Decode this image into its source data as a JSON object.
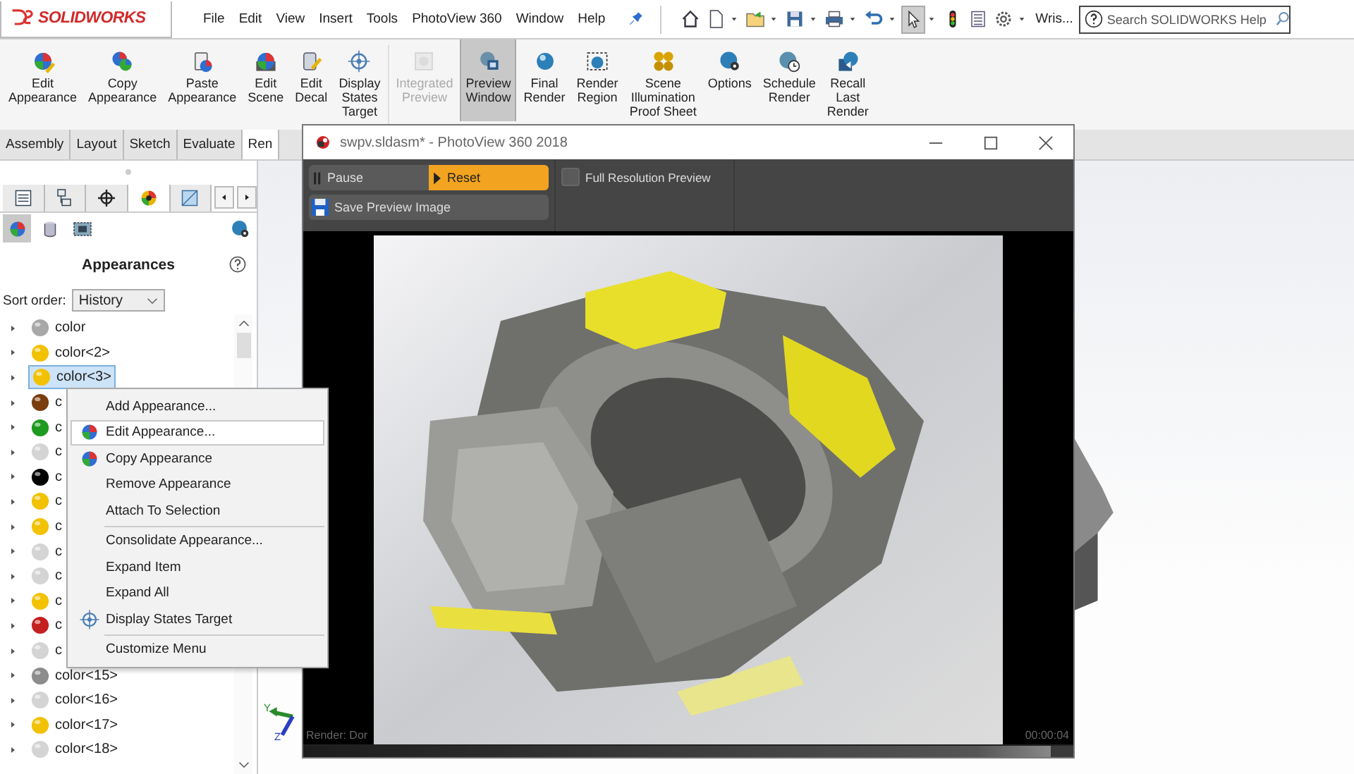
{
  "app": {
    "logo": "SOLIDWORKS"
  },
  "menu": [
    "File",
    "Edit",
    "View",
    "Insert",
    "Tools",
    "PhotoView 360",
    "Window",
    "Help"
  ],
  "quick_access": [
    {
      "selected": false
    },
    {
      "selected": false
    },
    {
      "selected": false
    },
    {
      "selected": false
    },
    {
      "selected": false
    },
    {
      "selected": false
    },
    {
      "selected": true
    },
    {
      "selected": false
    },
    {
      "selected": false
    },
    {
      "selected": false
    }
  ],
  "document_name": "Wris...",
  "search": {
    "placeholder": "Search SOLIDWORKS Help"
  },
  "ribbon": [
    {
      "lines": [
        "Edit",
        "Appearance"
      ],
      "selected": false,
      "disabled": false
    },
    {
      "lines": [
        "Copy",
        "Appearance"
      ],
      "selected": false,
      "disabled": false
    },
    {
      "lines": [
        "Paste",
        "Appearance"
      ],
      "selected": false,
      "disabled": false
    },
    {
      "lines": [
        "Edit",
        "Scene"
      ],
      "selected": false,
      "disabled": false
    },
    {
      "lines": [
        "Edit",
        "Decal"
      ],
      "selected": false,
      "disabled": false
    },
    {
      "lines": [
        "Display",
        "States",
        "Target"
      ],
      "selected": false,
      "disabled": false
    },
    {
      "lines": [
        "Integrated",
        "Preview"
      ],
      "selected": false,
      "disabled": true
    },
    {
      "lines": [
        "Preview",
        "Window"
      ],
      "selected": true,
      "disabled": false
    },
    {
      "lines": [
        "Final",
        "Render"
      ],
      "selected": false,
      "disabled": false
    },
    {
      "lines": [
        "Render",
        "Region"
      ],
      "selected": false,
      "disabled": false
    },
    {
      "lines": [
        "Scene",
        "Illumination",
        "Proof Sheet"
      ],
      "selected": false,
      "disabled": false
    },
    {
      "lines": [
        "Options"
      ],
      "selected": false,
      "disabled": false
    },
    {
      "lines": [
        "Schedule",
        "Render"
      ],
      "selected": false,
      "disabled": false
    },
    {
      "lines": [
        "Recall",
        "Last",
        "Render"
      ],
      "selected": false,
      "disabled": false
    }
  ],
  "command_tabs": [
    {
      "label": "Assembly",
      "selected": false
    },
    {
      "label": "Layout",
      "selected": false
    },
    {
      "label": "Sketch",
      "selected": false
    },
    {
      "label": "Evaluate",
      "selected": false
    },
    {
      "label": "Ren",
      "selected": true
    }
  ],
  "panel": {
    "tabs": [
      {
        "selected": false
      },
      {
        "selected": false
      },
      {
        "selected": false
      },
      {
        "selected": true
      },
      {
        "selected": false
      }
    ],
    "filters": [
      {
        "selected": true
      },
      {
        "selected": false
      },
      {
        "selected": false
      }
    ],
    "title": "Appearances",
    "sort_label": "Sort order:",
    "sort_value": "History",
    "items": [
      {
        "label": "color",
        "color": "#a8a8a8",
        "selected": false
      },
      {
        "label": "color<2>",
        "color": "#f2c200",
        "selected": false
      },
      {
        "label": "color<3>",
        "color": "#f2c200",
        "selected": true
      },
      {
        "label": "c",
        "color": "#7a3e0e",
        "selected": false
      },
      {
        "label": "c",
        "color": "#1e9a1e",
        "selected": false
      },
      {
        "label": "c",
        "color": "#d4d4d4",
        "selected": false
      },
      {
        "label": "c",
        "color": "#000000",
        "selected": false
      },
      {
        "label": "c",
        "color": "#f2c200",
        "selected": false
      },
      {
        "label": "c",
        "color": "#f2c200",
        "selected": false
      },
      {
        "label": "c",
        "color": "#d4d4d4",
        "selected": false
      },
      {
        "label": "c",
        "color": "#d4d4d4",
        "selected": false
      },
      {
        "label": "c",
        "color": "#f2c200",
        "selected": false
      },
      {
        "label": "c",
        "color": "#c42020",
        "selected": false
      },
      {
        "label": "c",
        "color": "#d4d4d4",
        "selected": false
      },
      {
        "label": "color<15>",
        "color": "#8c8c8c",
        "selected": false
      },
      {
        "label": "color<16>",
        "color": "#d4d4d4",
        "selected": false
      },
      {
        "label": "color<17>",
        "color": "#f2c200",
        "selected": false
      },
      {
        "label": "color<18>",
        "color": "#d4d4d4",
        "selected": false
      }
    ]
  },
  "triad": {
    "labels": [
      "Y",
      "Z"
    ]
  },
  "photoview": {
    "title": "swpv.sldasm* - PhotoView 360 2018",
    "controls": [
      {
        "label": "Pause",
        "kind": "pause"
      },
      {
        "label": "Reset",
        "kind": "play"
      }
    ],
    "checkbox": {
      "label": "Full Resolution Preview",
      "checked": false
    },
    "save": {
      "label": "Save Preview Image"
    },
    "status": "Render: Dor",
    "elapsed": "00:00:04",
    "progress": {
      "level": 0.97
    }
  },
  "context_menu": [
    [
      {
        "label": "Add Appearance...",
        "kind": "plain",
        "selected": false
      },
      {
        "label": "Edit Appearance...",
        "kind": "appearance",
        "selected": true
      },
      {
        "label": "Copy Appearance",
        "kind": "appearance",
        "selected": false
      },
      {
        "label": "Remove Appearance",
        "kind": "plain",
        "selected": false
      },
      {
        "label": "Attach To Selection",
        "kind": "plain",
        "selected": false
      }
    ],
    [
      {
        "label": "Consolidate Appearance...",
        "kind": "plain",
        "selected": false
      },
      {
        "label": "Expand Item",
        "kind": "plain",
        "selected": false
      },
      {
        "label": "Expand All",
        "kind": "plain",
        "selected": false
      },
      {
        "label": "Display States Target",
        "kind": "target",
        "selected": false
      }
    ],
    [
      {
        "label": "Customize Menu",
        "kind": "plain",
        "selected": false
      }
    ]
  ]
}
